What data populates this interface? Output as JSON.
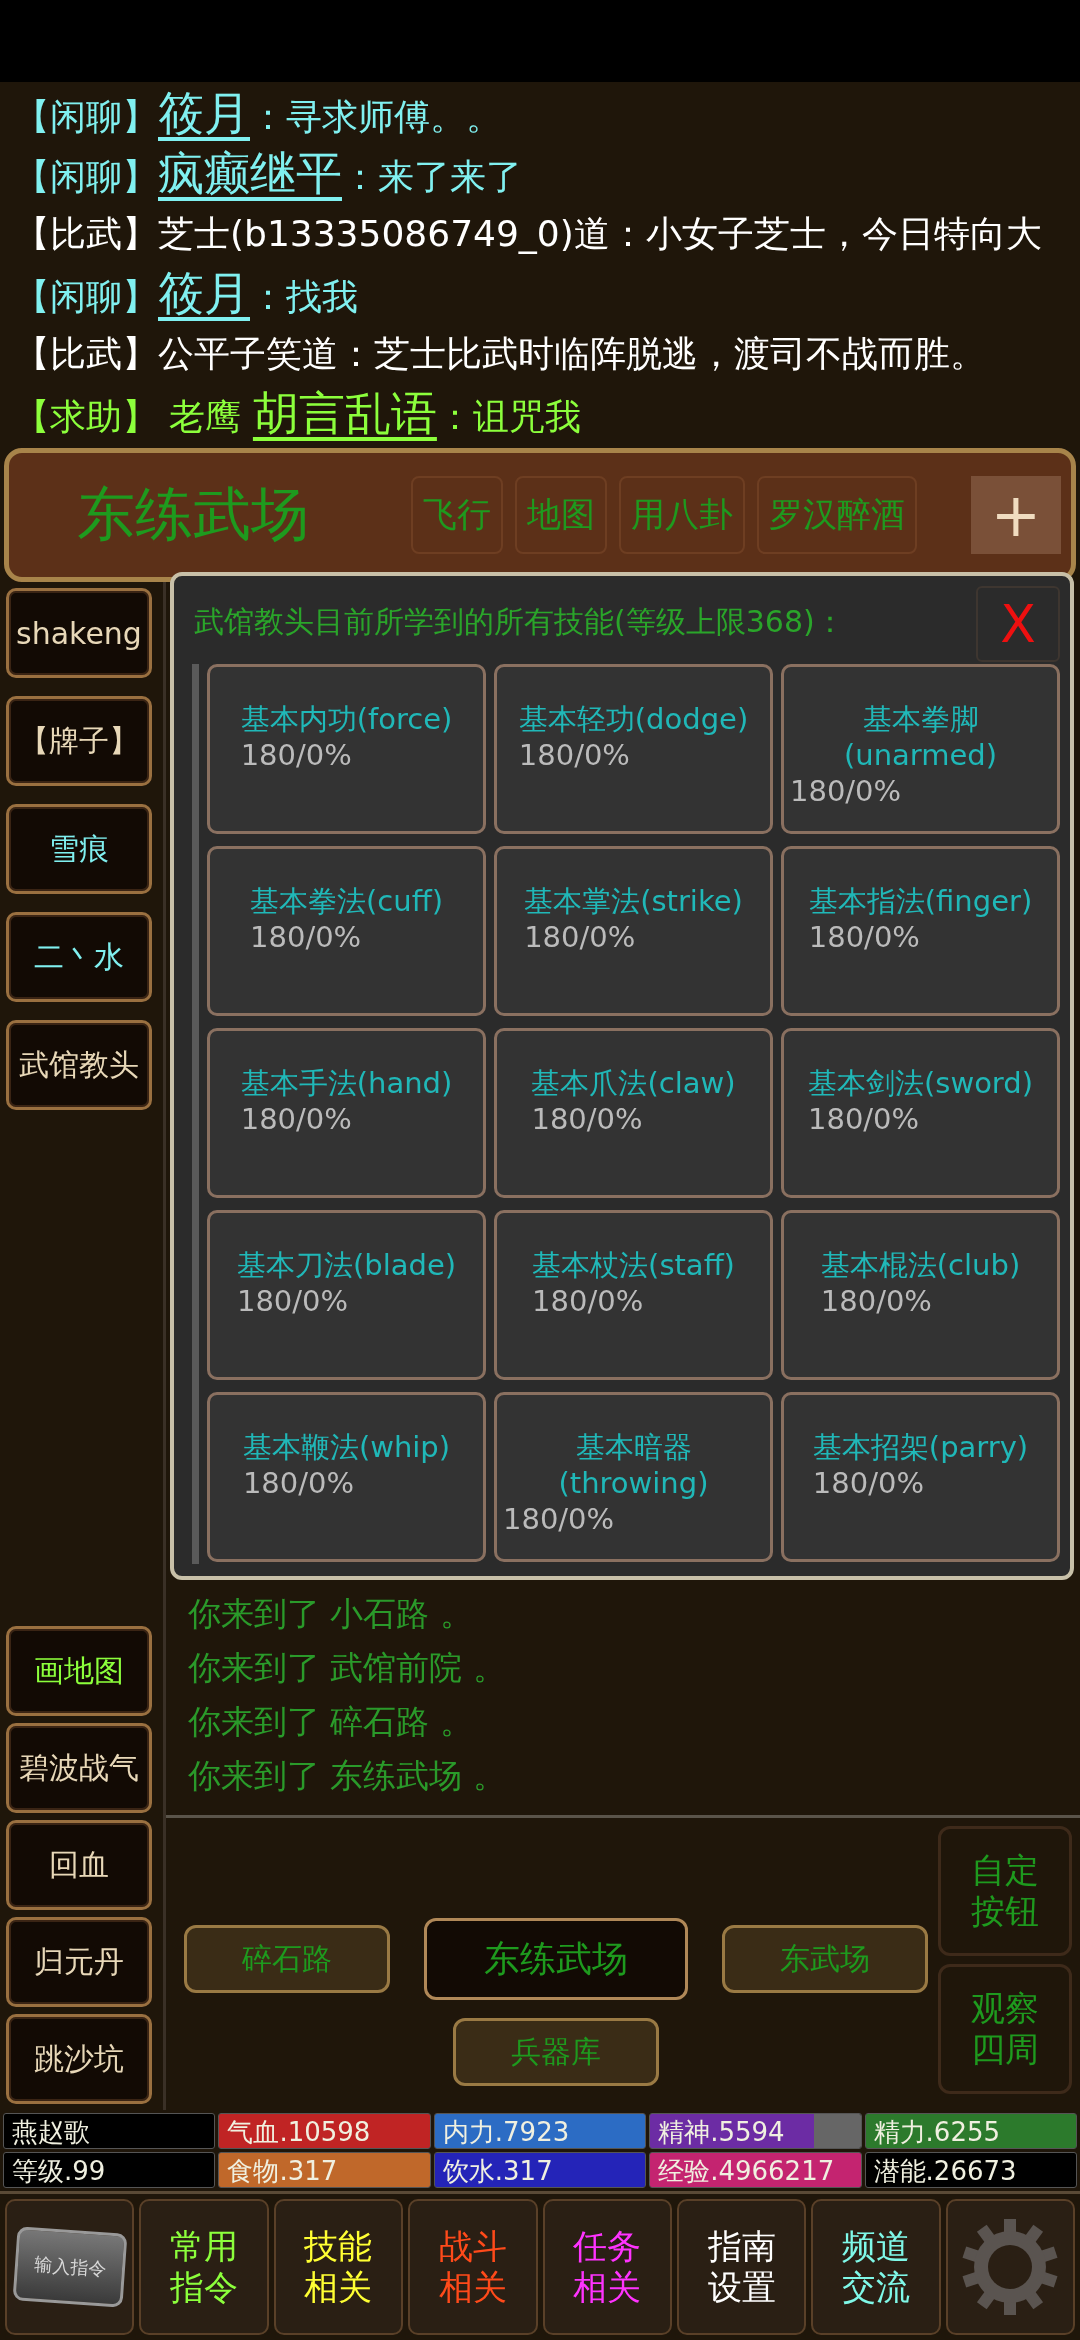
{
  "chat": [
    {
      "channel": "【闲聊】",
      "kind": "chat",
      "name": "筱月",
      "text": "：寻求师傅。。"
    },
    {
      "channel": "【闲聊】",
      "kind": "chat",
      "name": "疯癫继平",
      "text": "：来了来了"
    },
    {
      "channel": "【比武】",
      "kind": "duel",
      "text": "芝士(b13335086749_0)道：小女子芝士，今日特向大"
    },
    {
      "channel": "【闲聊】",
      "kind": "chat",
      "name": "筱月",
      "text": "：找我"
    },
    {
      "channel": "【比武】",
      "kind": "duel",
      "text": "公平子笑道：芝士比武时临阵脱逃，渡司不战而胜。"
    },
    {
      "channel": "【求助】",
      "kind": "help",
      "prefix": "老鹰",
      "name": "胡言乱语",
      "text": "：诅咒我"
    }
  ],
  "location": {
    "title": "东练武场",
    "actions": [
      "飞行",
      "地图",
      "用八卦",
      "罗汉醉酒"
    ],
    "add_button": "+"
  },
  "sidebar_top": [
    {
      "label": "shakeng",
      "color": "#e8d8b8"
    },
    {
      "label": "【牌子】",
      "color": "#e8d8b8"
    },
    {
      "label": "雪痕",
      "color": "#80f0f0"
    },
    {
      "label": "二丶水",
      "color": "#80f0f0"
    },
    {
      "label": "武馆教头",
      "color": "#e8d8b8"
    }
  ],
  "sidebar_bottom": [
    {
      "label": "画地图",
      "color": "#8cff3c"
    },
    {
      "label": "碧波战气",
      "color": "#e8d8b8"
    },
    {
      "label": "回血",
      "color": "#e8d8b8"
    },
    {
      "label": "归元丹",
      "color": "#e8d8b8"
    },
    {
      "label": "跳沙坑",
      "color": "#e8d8b8"
    }
  ],
  "dialog": {
    "title": "武馆教头目前所学到的所有技能(等级上限368)：",
    "close": "X",
    "skills": [
      {
        "name": "基本内功(force)",
        "value": "180/0%"
      },
      {
        "name": "基本轻功(dodge)",
        "value": "180/0%"
      },
      {
        "name": "基本拳脚(unarmed)",
        "value": "180/0%"
      },
      {
        "name": "基本拳法(cuff)",
        "value": "180/0%"
      },
      {
        "name": "基本掌法(strike)",
        "value": "180/0%"
      },
      {
        "name": "基本指法(finger)",
        "value": "180/0%"
      },
      {
        "name": "基本手法(hand)",
        "value": "180/0%"
      },
      {
        "name": "基本爪法(claw)",
        "value": "180/0%"
      },
      {
        "name": "基本剑法(sword)",
        "value": "180/0%"
      },
      {
        "name": "基本刀法(blade)",
        "value": "180/0%"
      },
      {
        "name": "基本杖法(staff)",
        "value": "180/0%"
      },
      {
        "name": "基本棍法(club)",
        "value": "180/0%"
      },
      {
        "name": "基本鞭法(whip)",
        "value": "180/0%"
      },
      {
        "name": "基本暗器(throwing)",
        "value": "180/0%"
      },
      {
        "name": "基本招架(parry)",
        "value": "180/0%"
      }
    ]
  },
  "log": [
    "你来到了 小石路 。",
    "你来到了 武馆前院 。",
    "你来到了 碎石路 。",
    "你来到了 东练武场 。"
  ],
  "exits": [
    {
      "label": "碎石路",
      "selected": false
    },
    {
      "label": "东练武场",
      "selected": true
    },
    {
      "label": "东武场",
      "selected": false
    },
    {
      "label": "兵器库",
      "selected": false
    }
  ],
  "side_actions": [
    "自定按钮",
    "观察四周"
  ],
  "stats": [
    {
      "label": "燕赵歌",
      "kind": "plain"
    },
    {
      "label": "气血.10598",
      "kind": "bar",
      "color": "#c02424",
      "level": 1
    },
    {
      "label": "内力.7923",
      "kind": "bar",
      "color": "#2c6cc4",
      "level": 1
    },
    {
      "label": "精神.5594",
      "kind": "bar",
      "color": "#6c2ca4",
      "level": 0.78
    },
    {
      "label": "精力.6255",
      "kind": "bar",
      "color": "#2c7a2c",
      "level": 1
    },
    {
      "label": "等级.99",
      "kind": "plain"
    },
    {
      "label": "食物.317",
      "kind": "bar",
      "color": "#c0682a",
      "level": 1
    },
    {
      "label": "饮水.317",
      "kind": "bar",
      "color": "#2424b8",
      "level": 1
    },
    {
      "label": "经验.4966217",
      "kind": "bar",
      "color": "#c42470",
      "level": 1
    },
    {
      "label": "潜能.26673",
      "kind": "plain"
    }
  ],
  "command_key": "输入指令",
  "menu": [
    {
      "label": "常用指令",
      "color": "#8cff3c"
    },
    {
      "label": "技能相关",
      "color": "#ffff33"
    },
    {
      "label": "战斗相关",
      "color": "#ff4a1a"
    },
    {
      "label": "任务相关",
      "color": "#ff33ff"
    },
    {
      "label": "指南设置",
      "color": "#ffffff"
    },
    {
      "label": "频道交流",
      "color": "#7ff8e8"
    }
  ]
}
